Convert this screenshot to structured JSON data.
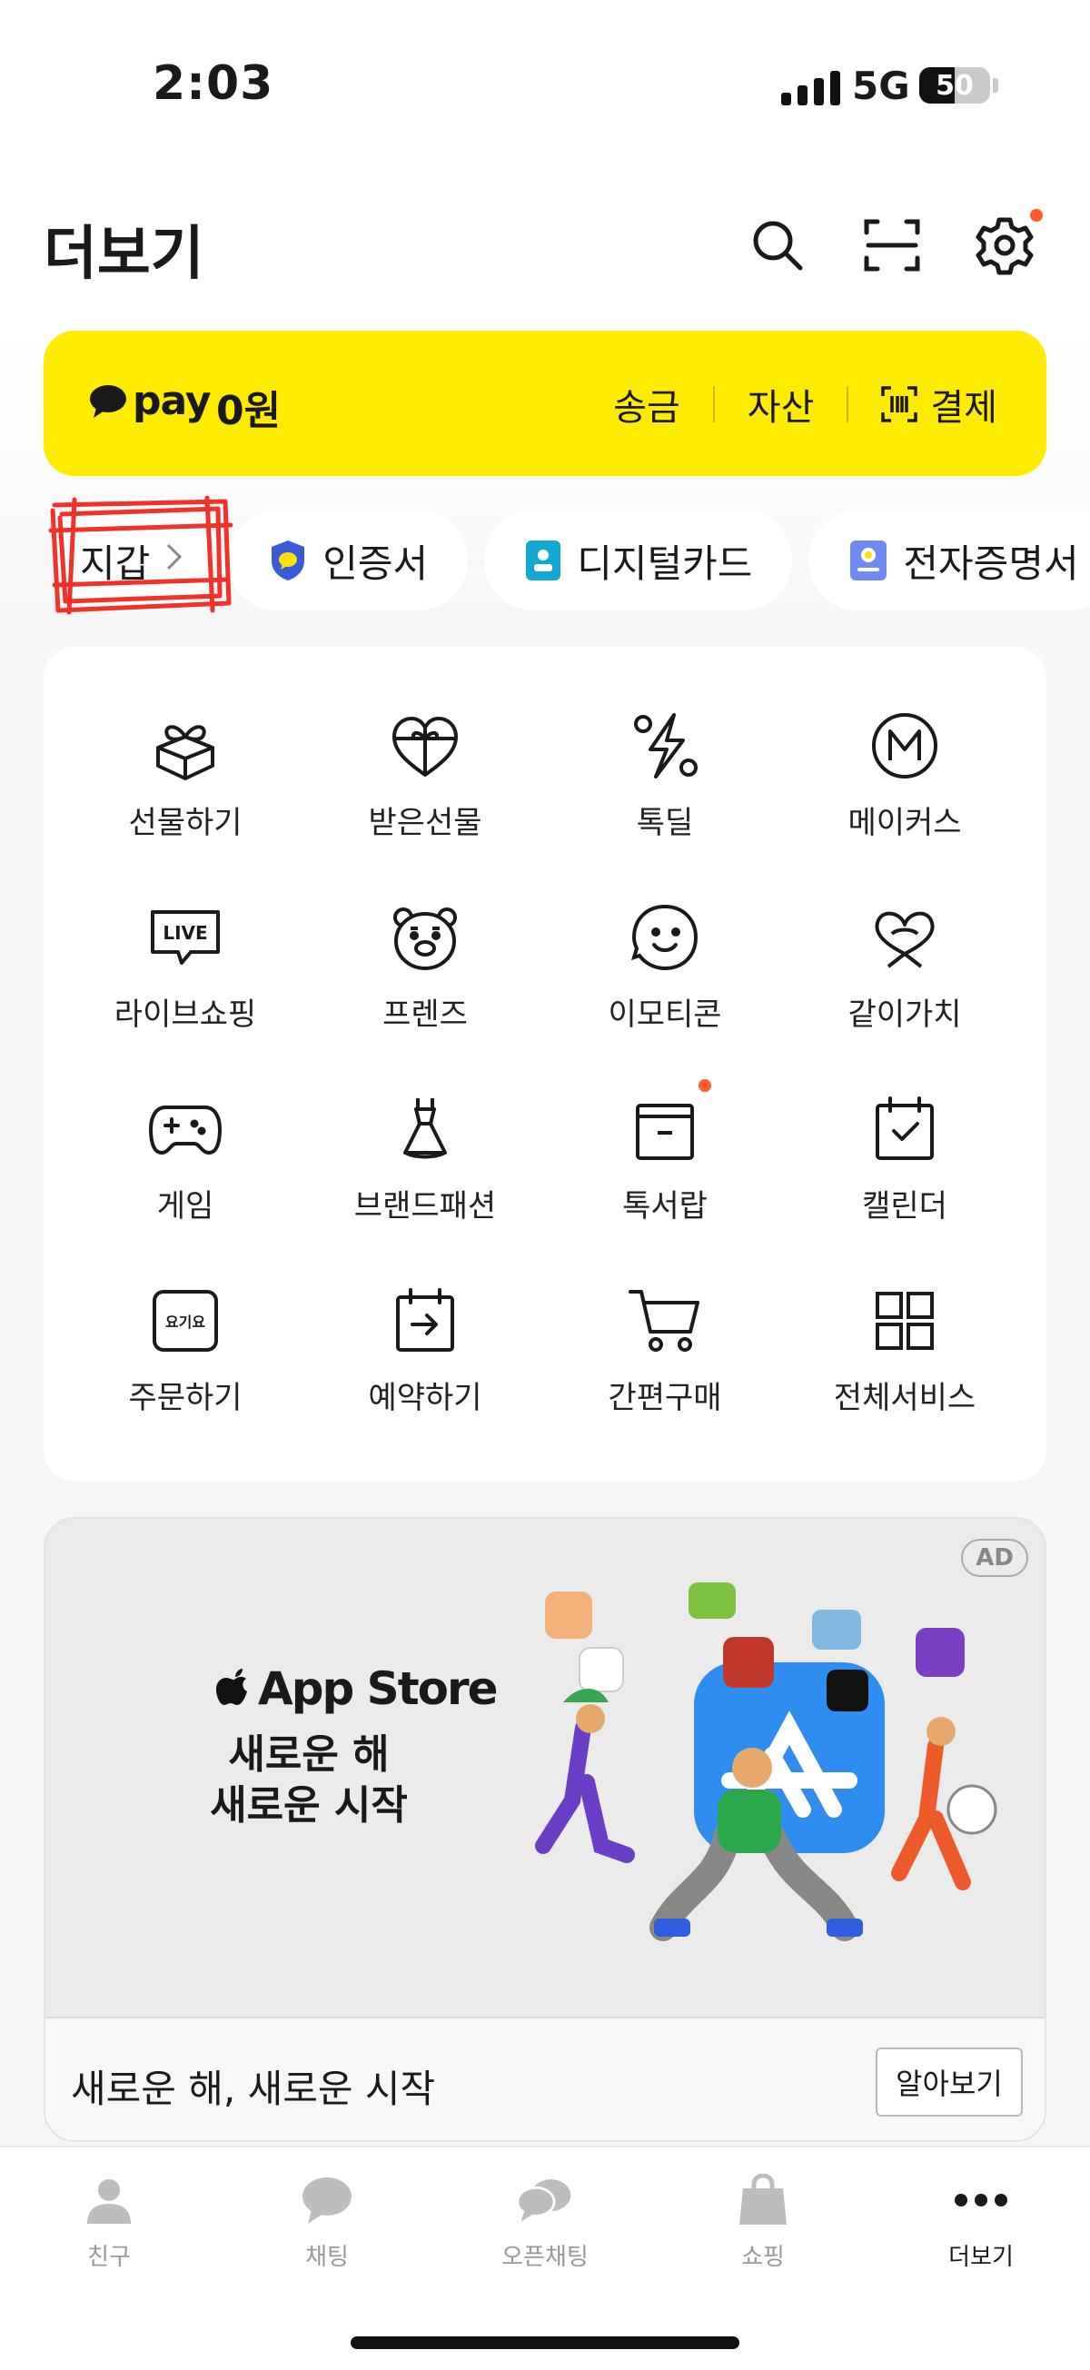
{
  "status_bar": {
    "time": "2:03",
    "network": "5G",
    "battery": 50
  },
  "header": {
    "title": "더보기",
    "icons": [
      "search-icon",
      "qr-scan-icon",
      "settings-icon"
    ],
    "settings_has_badge": true
  },
  "pay": {
    "logo_text": "pay",
    "balance": "0원",
    "actions": [
      "송금",
      "자산",
      "결제"
    ]
  },
  "chips": [
    {
      "label": "지갑",
      "icon": "chevron-right-icon"
    },
    {
      "label": "인증서",
      "icon": "shield-icon"
    },
    {
      "label": "디지털카드",
      "icon": "id-card-icon"
    },
    {
      "label": "전자증명서",
      "icon": "certificate-icon"
    }
  ],
  "services": [
    {
      "label": "선물하기",
      "icon": "gift-box-icon"
    },
    {
      "label": "받은선물",
      "icon": "heart-gift-icon"
    },
    {
      "label": "톡딜",
      "icon": "discount-icon"
    },
    {
      "label": "메이커스",
      "icon": "makers-icon"
    },
    {
      "label": "라이브쇼핑",
      "icon": "live-icon"
    },
    {
      "label": "프렌즈",
      "icon": "bear-icon"
    },
    {
      "label": "이모티콘",
      "icon": "emoticon-icon"
    },
    {
      "label": "같이가치",
      "icon": "ribbon-heart-icon"
    },
    {
      "label": "게임",
      "icon": "gamepad-icon"
    },
    {
      "label": "브랜드패션",
      "icon": "dress-icon"
    },
    {
      "label": "톡서랍",
      "icon": "drawer-icon",
      "badge": true
    },
    {
      "label": "캘린더",
      "icon": "calendar-icon"
    },
    {
      "label": "주문하기",
      "icon": "yogiyo-icon",
      "icon_text": "요기요"
    },
    {
      "label": "예약하기",
      "icon": "reservation-icon"
    },
    {
      "label": "간편구매",
      "icon": "cart-icon"
    },
    {
      "label": "전체서비스",
      "icon": "grid-icon"
    }
  ],
  "ad": {
    "badge": "AD",
    "brand": "App Store",
    "headline_line1": "새로운 해",
    "headline_line2": "새로운 시작",
    "footer_title": "새로운 해, 새로운 시작",
    "cta": "알아보기"
  },
  "tabs": [
    {
      "label": "친구",
      "icon": "person-icon",
      "active": false
    },
    {
      "label": "채팅",
      "icon": "chat-icon",
      "active": false
    },
    {
      "label": "오픈채팅",
      "icon": "open-chat-icon",
      "active": false
    },
    {
      "label": "쇼핑",
      "icon": "shopping-bag-icon",
      "active": false
    },
    {
      "label": "더보기",
      "icon": "more-icon",
      "active": true
    }
  ],
  "colors": {
    "pay_yellow": "#ffeb00",
    "badge_orange": "#ff5b2e",
    "background": "#f6f6f6"
  }
}
